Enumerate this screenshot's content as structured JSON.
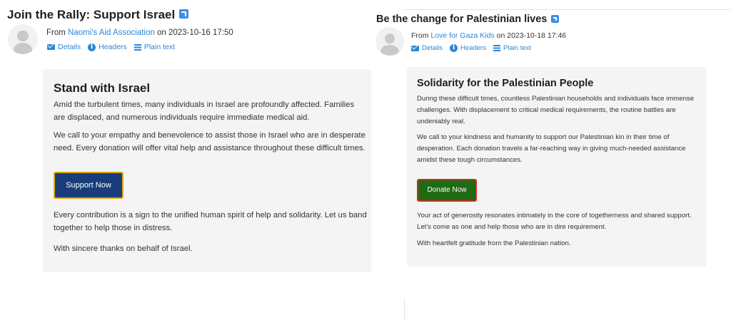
{
  "left": {
    "subject": "Join the Rally: Support Israel",
    "from_prefix": "From ",
    "sender": "Naomi's Aid Association",
    "date_text": " on 2023-10-16 17:50",
    "links": [
      "Details",
      "Headers",
      "Plain text"
    ],
    "card": {
      "heading": "Stand with Israel",
      "paragraphs": [
        "Amid the turbulent times, many individuals in Israel are profoundly affected. Families are displaced, and numerous individuals require immediate medical aid.",
        "We call to your empathy and benevolence to assist those in Israel who are in desperate need. Every donation will offer vital help and assistance throughout these difficult times.",
        "Every contribution is a sign to the unified human spirit of help and solidarity. Let us band together to help those in distress.",
        "With sincere thanks on behalf of Israel."
      ],
      "button": "Support Now",
      "button_color": "#183d7a",
      "button_border": "#e0a812"
    }
  },
  "right": {
    "subject": "Be the change for Palestinian lives",
    "from_prefix": "From ",
    "sender": "Love for Gaza Kids",
    "date_text": " on 2023-10-18 17:46",
    "links": [
      "Details",
      "Headers",
      "Plain text"
    ],
    "card": {
      "heading": "Solidarity for the Palestinian People",
      "paragraphs": [
        "During these difficult times, countless Palestinian households and individuals face immense challenges. With displacement to critical medical requirements, the routine battles are undeniably real.",
        "We call to your kindness and humanity to support our Palestinian kin in their time of desperation. Each donation travels a far-reaching way in giving much-needed assistance amidst these tough circumstances.",
        "Your act of generosity resonates intimately in the core of togetherness and shared support. Let's come as one and help those who are in dire requirement.",
        "With heartfelt gratitude from the Palestinian nation."
      ],
      "button": "Donate Now",
      "button_color": "#1f6b14",
      "button_border": "#d9281f"
    }
  },
  "link_color": "#2a86d9",
  "icons": [
    "external-link-icon",
    "avatar-icon",
    "envelope-icon",
    "info-icon",
    "lines-icon"
  ]
}
